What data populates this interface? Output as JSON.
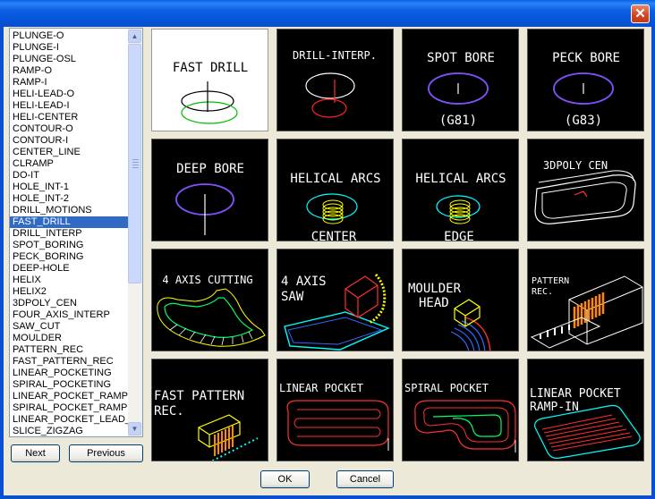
{
  "window": {
    "close_glyph": "✕"
  },
  "list": {
    "items": [
      "PLUNGE-O",
      "PLUNGE-I",
      "PLUNGE-OSL",
      "RAMP-O",
      "RAMP-I",
      "HELI-LEAD-O",
      "HELI-LEAD-I",
      "HELI-CENTER",
      "CONTOUR-O",
      "CONTOUR-I",
      "CENTER_LINE",
      "CLRAMP",
      "DO-IT",
      "HOLE_INT-1",
      "HOLE_INT-2",
      "DRILL_MOTIONS",
      "FAST_DRILL",
      "DRILL_INTERP",
      "SPOT_BORING",
      "PECK_BORING",
      "DEEP-HOLE",
      "HELIX",
      "HELIX2",
      "3DPOLY_CEN",
      "FOUR_AXIS_INTERP",
      "SAW_CUT",
      "MOULDER",
      "PATTERN_REC",
      "FAST_PATTERN_REC",
      "LINEAR_POCKETING",
      "SPIRAL_POCKETING",
      "LINEAR_POCKET_RAMP",
      "SPIRAL_POCKET_RAMP",
      "LINEAR_POCKET_LEAD_",
      "SLICE_ZIGZAG"
    ],
    "selected_index": 16
  },
  "buttons": {
    "next": "Next",
    "previous": "Previous",
    "ok": "OK",
    "cancel": "Cancel"
  },
  "tiles": {
    "fast_drill": "FAST DRILL",
    "drill_interp": "DRILL-INTERP.",
    "spot_bore": "SPOT BORE",
    "spot_bore_code": "(G81)",
    "peck_bore": "PECK BORE",
    "peck_bore_code": "(G83)",
    "deep_bore": "DEEP BORE",
    "helical_center_1": "HELICAL ARCS",
    "helical_center_2": "CENTER",
    "helical_edge_1": "HELICAL ARCS",
    "helical_edge_2": "EDGE",
    "poly_cen": "3DPOLY CEN",
    "four_axis": "4 AXIS CUTTING",
    "saw_1": "4 AXIS",
    "saw_2": "SAW",
    "moulder_1": "MOULDER",
    "moulder_2": "HEAD",
    "pattern_1": "PATTERN",
    "pattern_2": "REC.",
    "fast_pattern_1": "FAST PATTERN",
    "fast_pattern_2": "REC.",
    "linear_pocket": "LINEAR POCKET",
    "spiral_pocket": "SPIRAL POCKET",
    "linear_ramp_1": "LINEAR POCKET",
    "linear_ramp_2": "RAMP-IN"
  }
}
